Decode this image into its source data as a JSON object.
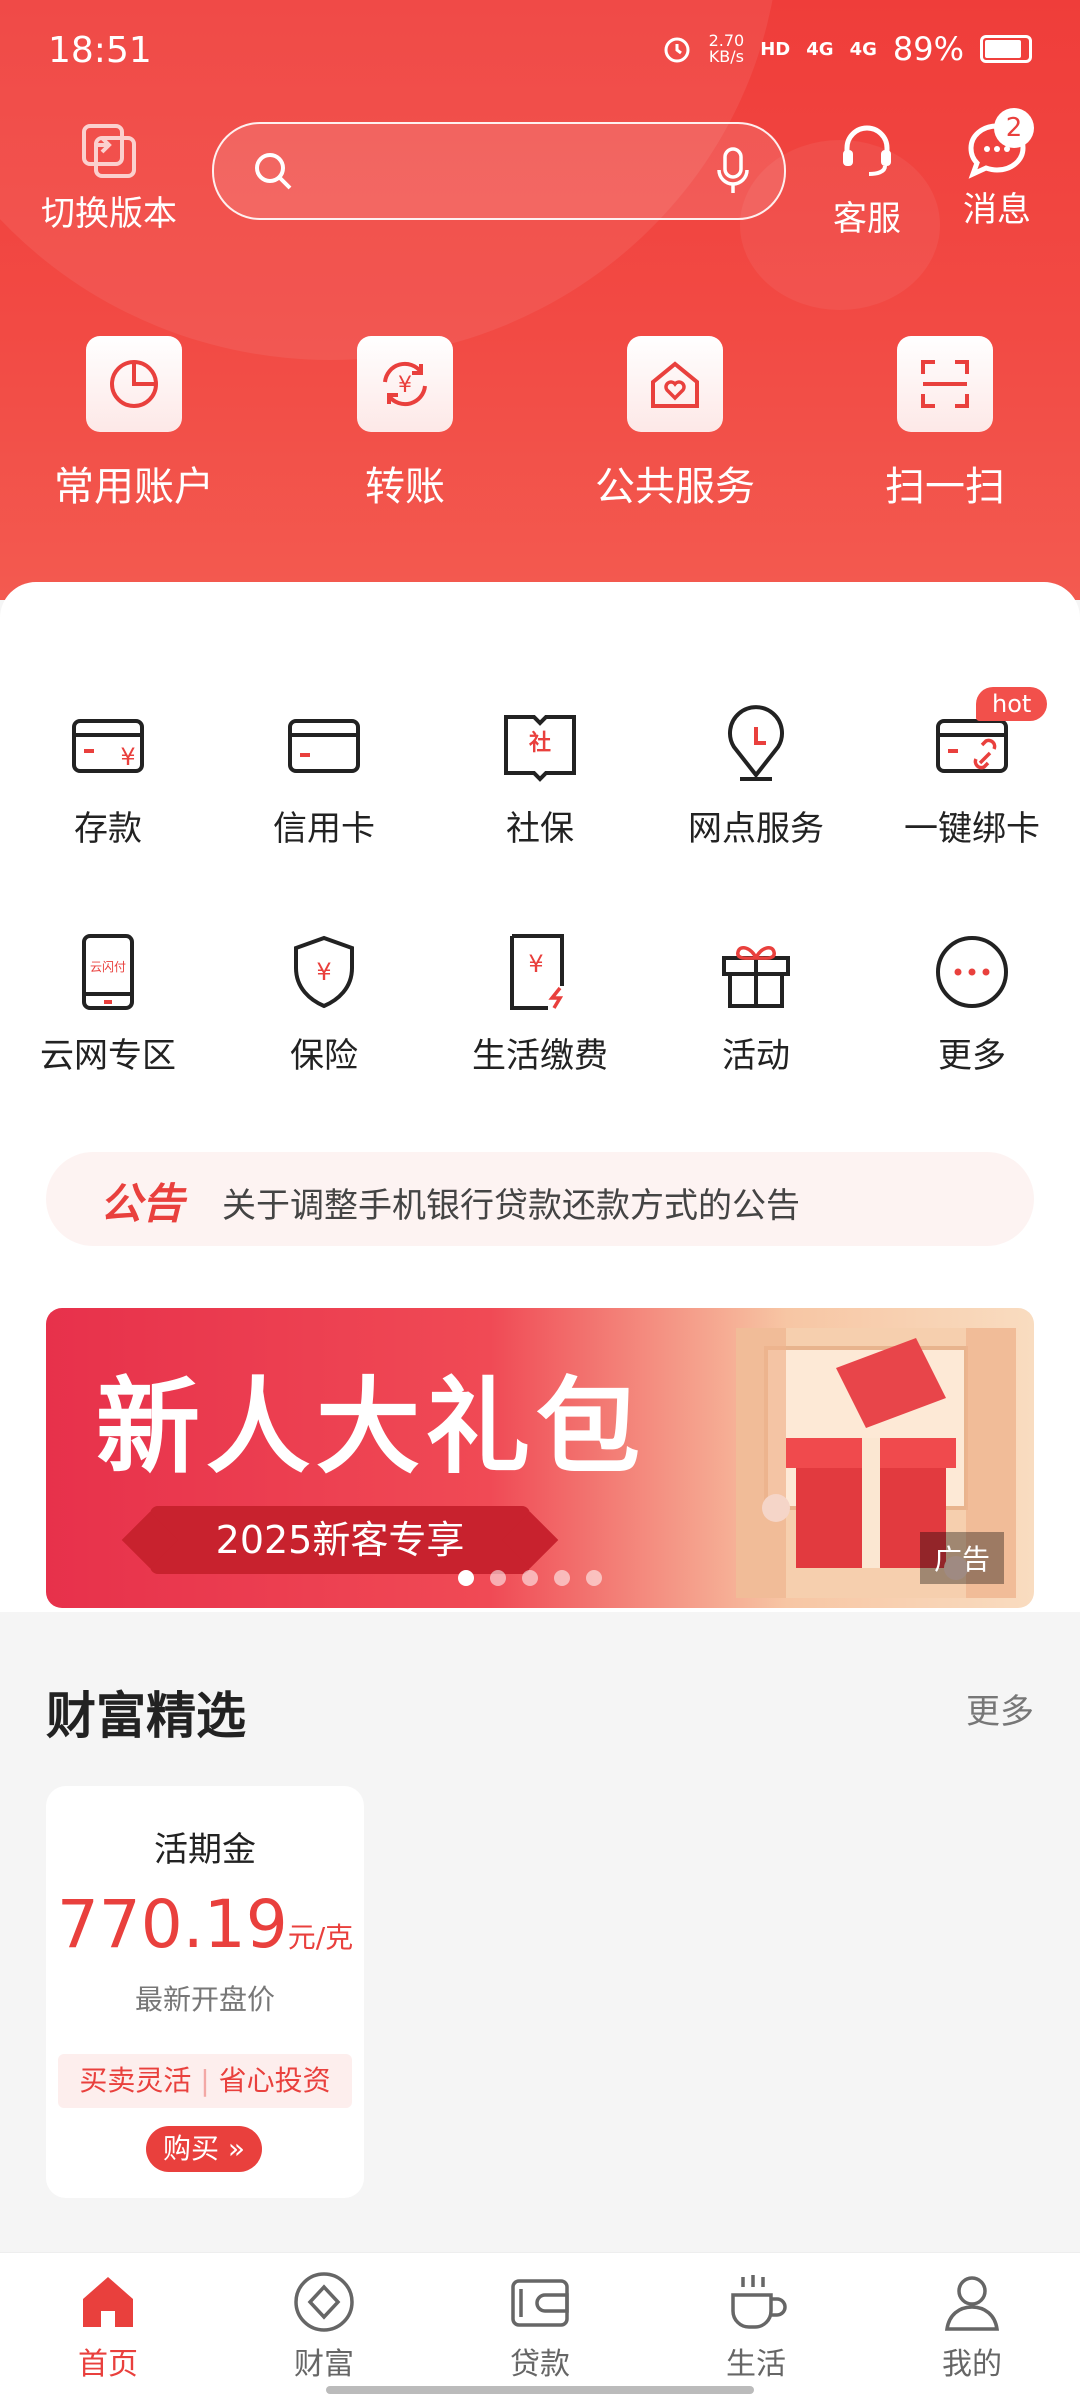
{
  "status_bar": {
    "time": "18:51",
    "net_speed": "2.70",
    "net_unit": "KB/s",
    "hd": "HD",
    "sim1": "4G",
    "sim2": "4G",
    "battery": "89%"
  },
  "header": {
    "switch_label": "切换版本",
    "service_label": "客服",
    "message_label": "消息",
    "message_badge": "2"
  },
  "quick_actions": [
    {
      "label": "常用账户",
      "icon": "pie-chart-icon"
    },
    {
      "label": "转账",
      "icon": "transfer-icon"
    },
    {
      "label": "公共服务",
      "icon": "house-heart-icon"
    },
    {
      "label": "扫一扫",
      "icon": "scan-icon"
    }
  ],
  "services": [
    {
      "label": "存款",
      "icon": "deposit-card-icon"
    },
    {
      "label": "信用卡",
      "icon": "credit-card-icon"
    },
    {
      "label": "社保",
      "icon": "social-security-book-icon",
      "glyph": "社"
    },
    {
      "label": "网点服务",
      "icon": "location-pin-icon"
    },
    {
      "label": "一键绑卡",
      "icon": "bind-card-icon",
      "tag": "hot"
    },
    {
      "label": "云网专区",
      "icon": "phone-icon",
      "glyph": "云闪付"
    },
    {
      "label": "保险",
      "icon": "shield-icon"
    },
    {
      "label": "生活缴费",
      "icon": "bill-icon"
    },
    {
      "label": "活动",
      "icon": "gift-icon"
    },
    {
      "label": "更多",
      "icon": "more-icon"
    }
  ],
  "notice": {
    "tag": "公告",
    "text": "关于调整手机银行贷款还款方式的公告"
  },
  "banner": {
    "title": "新人大礼包",
    "subtitle": "2025新客专享",
    "ad_tag": "广告",
    "dots": 5,
    "active_dot": 0
  },
  "wealth": {
    "title": "财富精选",
    "more": "更多",
    "product": {
      "name": "活期金",
      "price": "770.19",
      "unit": "元/克",
      "desc": "最新开盘价",
      "tag1": "买卖灵活",
      "tag2": "省心投资",
      "buy": "购买 »"
    }
  },
  "tabbar": [
    {
      "label": "首页",
      "icon": "home-icon",
      "active": true
    },
    {
      "label": "财富",
      "icon": "wealth-icon"
    },
    {
      "label": "贷款",
      "icon": "wallet-icon"
    },
    {
      "label": "生活",
      "icon": "coffee-cup-icon"
    },
    {
      "label": "我的",
      "icon": "user-icon"
    }
  ],
  "colors": {
    "brand": "#e9403d",
    "header_bg": "#ef3d3a",
    "card_bg": "#ffffff",
    "page_bg": "#f5f5f5"
  }
}
